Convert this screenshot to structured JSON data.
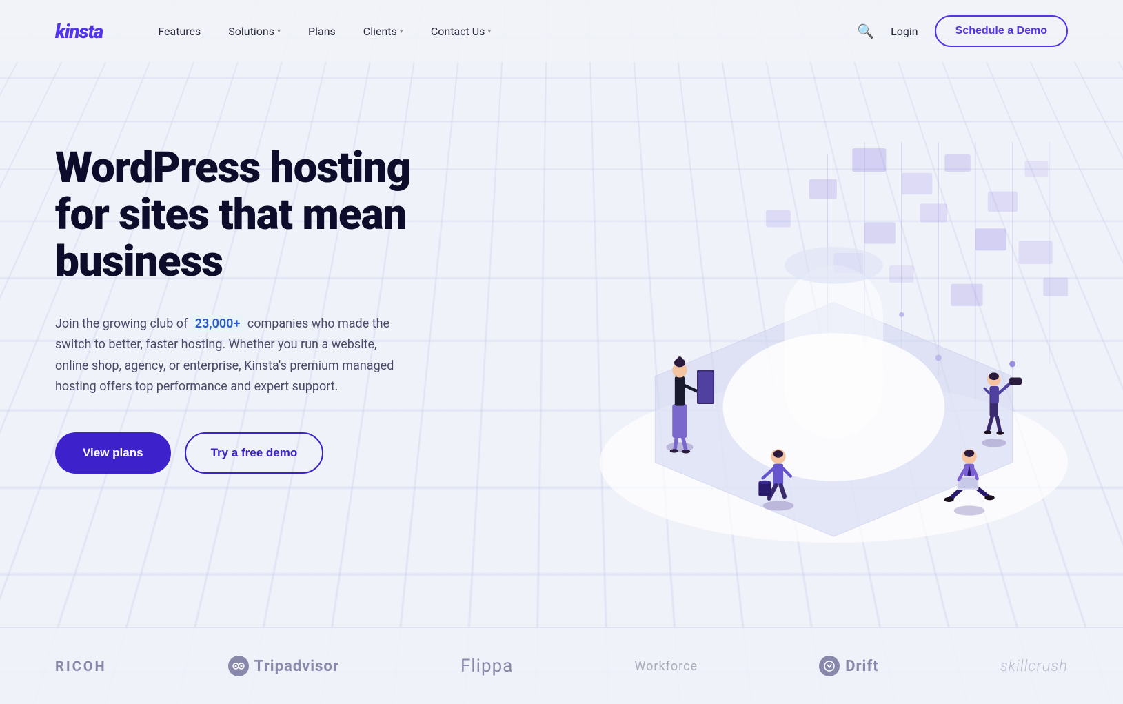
{
  "brand": {
    "name": "kinsta",
    "color": "#5333ed"
  },
  "nav": {
    "links": [
      {
        "label": "Features",
        "hasDropdown": false
      },
      {
        "label": "Solutions",
        "hasDropdown": true
      },
      {
        "label": "Plans",
        "hasDropdown": false
      },
      {
        "label": "Clients",
        "hasDropdown": true
      },
      {
        "label": "Contact Us",
        "hasDropdown": true
      }
    ],
    "login_label": "Login",
    "schedule_label": "Schedule a Demo"
  },
  "hero": {
    "title": "WordPress hosting for sites that mean business",
    "description_before": "Join the growing club of ",
    "highlight": "23,000+",
    "description_after": " companies who made the switch to better, faster hosting. Whether you run a website, online shop, agency, or enterprise, Kinsta's premium managed hosting offers top performance and expert support.",
    "btn_primary": "View plans",
    "btn_secondary": "Try a free demo"
  },
  "clients": [
    {
      "name": "RICOH",
      "type": "text",
      "class": "ricoh"
    },
    {
      "name": "Tripadvisor",
      "type": "icon-text",
      "class": "tripadvisor"
    },
    {
      "name": "Flippa",
      "type": "text",
      "class": "flippa"
    },
    {
      "name": "Workforce",
      "type": "text",
      "class": "workforce"
    },
    {
      "name": "Drift",
      "type": "icon-text",
      "class": "drift"
    },
    {
      "name": "skillcrush",
      "type": "text",
      "class": "skillcrush"
    }
  ]
}
